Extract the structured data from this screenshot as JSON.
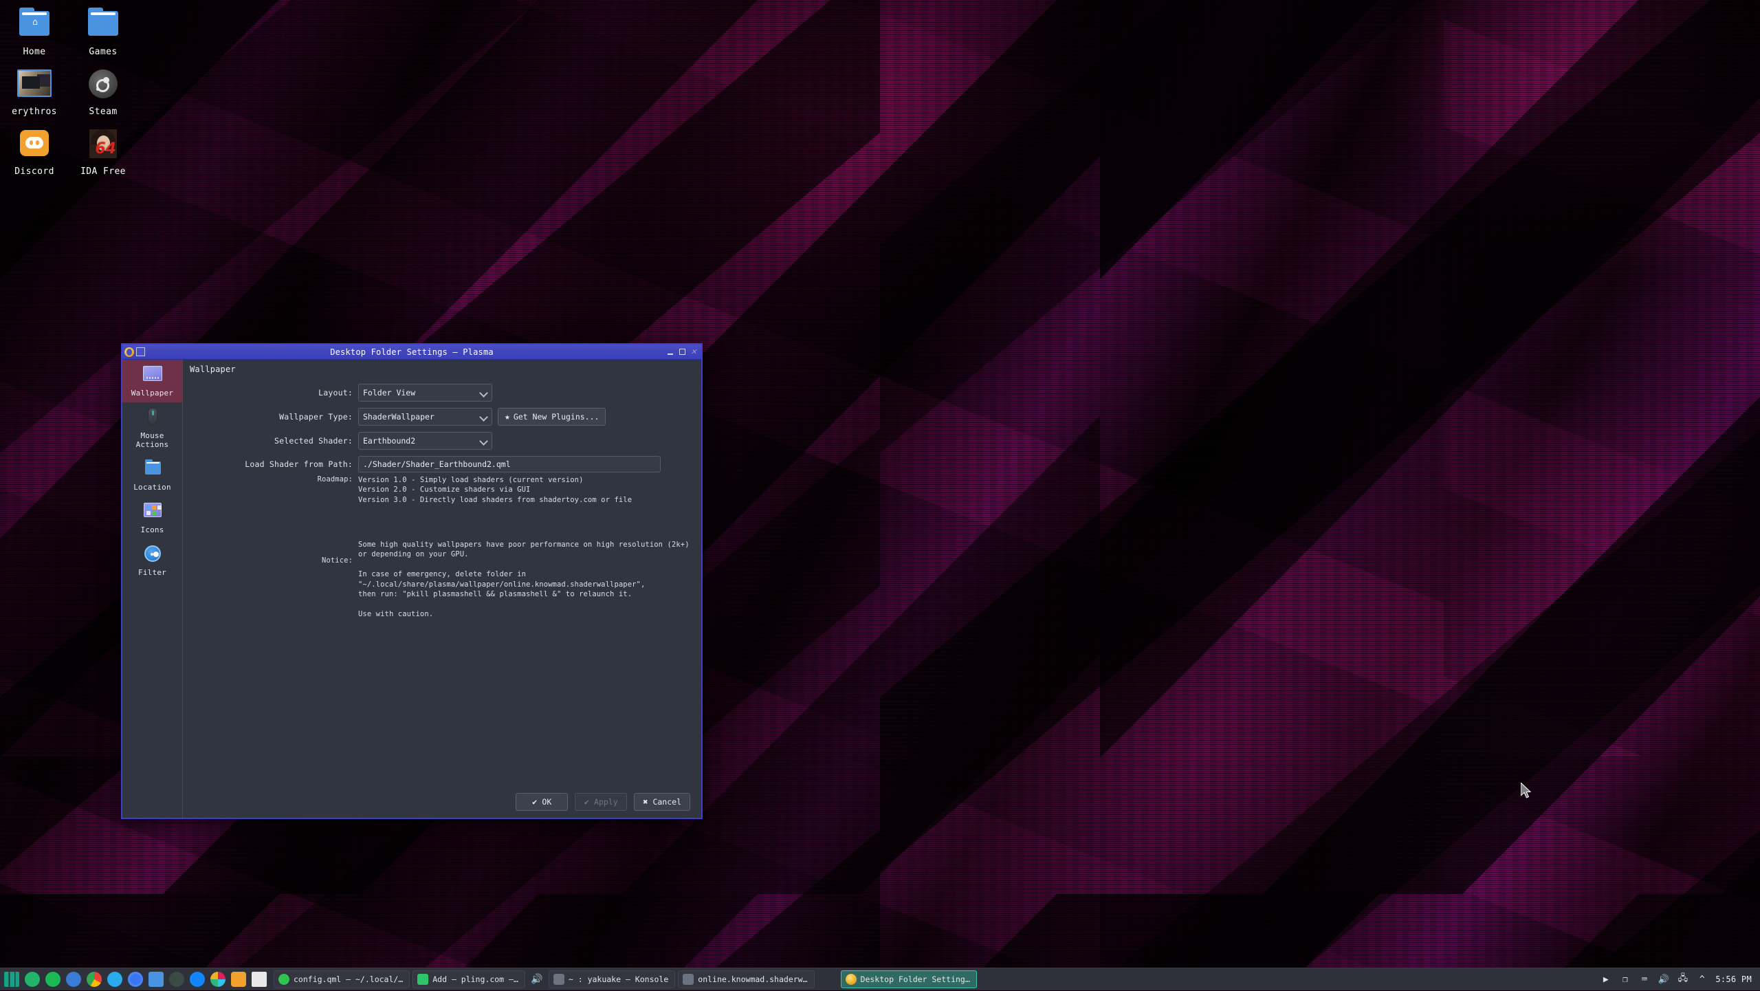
{
  "desktop": {
    "icons": [
      {
        "label": "Home",
        "icon": "folder-home-icon"
      },
      {
        "label": "Games",
        "icon": "folder-icon"
      },
      {
        "label": "erythros",
        "icon": "folder-pictures-icon"
      },
      {
        "label": "Steam",
        "icon": "steam-icon"
      },
      {
        "label": "Discord",
        "icon": "discord-icon"
      },
      {
        "label": "IDA Free",
        "icon": "ida-free-icon"
      }
    ],
    "wallpaper_accent": "#7d0a5e"
  },
  "dialog": {
    "title": "Desktop Folder Settings — Plasma",
    "app_icon": "plasma-icon",
    "window_buttons": {
      "minimize": "minimize-icon",
      "maximize": "maximize-icon",
      "close": "close-icon"
    },
    "sidebar": {
      "items": [
        {
          "label": "Wallpaper",
          "icon": "wallpaper-icon",
          "active": true
        },
        {
          "label": "Mouse Actions",
          "icon": "mouse-icon",
          "active": false
        },
        {
          "label": "Location",
          "icon": "folder-icon",
          "active": false
        },
        {
          "label": "Icons",
          "icon": "icons-grid-icon",
          "active": false
        },
        {
          "label": "Filter",
          "icon": "toggle-switch-icon",
          "active": false
        }
      ],
      "active_color": "#6e3148"
    },
    "panel_title": "Wallpaper",
    "form": {
      "layout": {
        "label": "Layout:",
        "value": "Folder View"
      },
      "wallpaper_type": {
        "label": "Wallpaper Type:",
        "value": "ShaderWallpaper"
      },
      "selected_shader": {
        "label": "Selected Shader:",
        "value": "Earthbound2"
      },
      "load_shader_path": {
        "label": "Load Shader from Path:",
        "value": "./Shader/Shader_Earthbound2.qml"
      },
      "get_new_plugins": {
        "label": "Get New Plugins...",
        "icon": "star-icon"
      }
    },
    "roadmap": {
      "label": "Roadmap:",
      "text": "Version 1.0 - Simply load shaders (current version)\nVersion 2.0 - Customize shaders via GUI\nVersion 3.0 - Directly load shaders from shadertoy.com or file"
    },
    "notice": {
      "label": "Notice:",
      "text": "Some high quality wallpapers have poor performance on high resolution (2k+)\nor depending on your GPU.\n\nIn case of emergency, delete folder in\n\"~/.local/share/plasma/wallpaper/online.knowmad.shaderwallpaper\",\nthen run: \"pkill plasmashell && plasmashell &\" to relaunch it.\n\nUse with caution."
    },
    "buttons": [
      {
        "label": "OK",
        "icon": "check-icon",
        "enabled": true
      },
      {
        "label": "Apply",
        "icon": "check-icon",
        "enabled": false
      },
      {
        "label": "Cancel",
        "icon": "cross-icon",
        "enabled": true
      }
    ]
  },
  "taskbar": {
    "launchers": [
      {
        "name": "manjaro-icon",
        "color": "#16a085"
      },
      {
        "name": "telegram-icon",
        "color": "#24b36b"
      },
      {
        "name": "spotify-icon",
        "color": "#1db954"
      },
      {
        "name": "thunderbird-icon",
        "color": "#3a7bd5"
      },
      {
        "name": "chrome-icon",
        "color": "#ea4335"
      },
      {
        "name": "telegram2-icon",
        "color": "#2aabee"
      },
      {
        "name": "signal-icon",
        "color": "#3a76f0"
      },
      {
        "name": "dolphin-icon",
        "color": "#4a93e0"
      },
      {
        "name": "keepassxc-icon",
        "color": "#3b4a44"
      },
      {
        "name": "bluesky-icon",
        "color": "#1185fe"
      },
      {
        "name": "slack-icon",
        "color": "#e01e5a"
      },
      {
        "name": "discord-icon",
        "color": "#f0a12e"
      },
      {
        "name": "unity-icon",
        "color": "#e8e8e8"
      }
    ],
    "tasks": [
      {
        "label": "config.qml — ~/.local/…",
        "icon": "kate-icon",
        "active": false
      },
      {
        "label": "Add — pling.com —…",
        "icon": "text-icon",
        "active": false
      },
      {
        "label": "~ : yakuake — Konsole",
        "icon": "konsole-icon",
        "active": false,
        "prefix_icon": "volume-icon"
      },
      {
        "label": "online.knowmad.shaderw…",
        "icon": "konsole-icon",
        "active": false
      },
      {
        "label": "Desktop Folder Setting…",
        "icon": "plasma-icon",
        "active": true
      }
    ],
    "tray": [
      {
        "name": "media-play-icon",
        "glyph": "▶"
      },
      {
        "name": "clipboard-icon",
        "glyph": "❐"
      },
      {
        "name": "keyboard-icon",
        "glyph": "⌨"
      },
      {
        "name": "volume-icon",
        "glyph": "🔊"
      },
      {
        "name": "network-icon",
        "glyph": "🖧"
      },
      {
        "name": "show-hidden-icon",
        "glyph": "^"
      }
    ],
    "clock": "5:56 PM"
  }
}
